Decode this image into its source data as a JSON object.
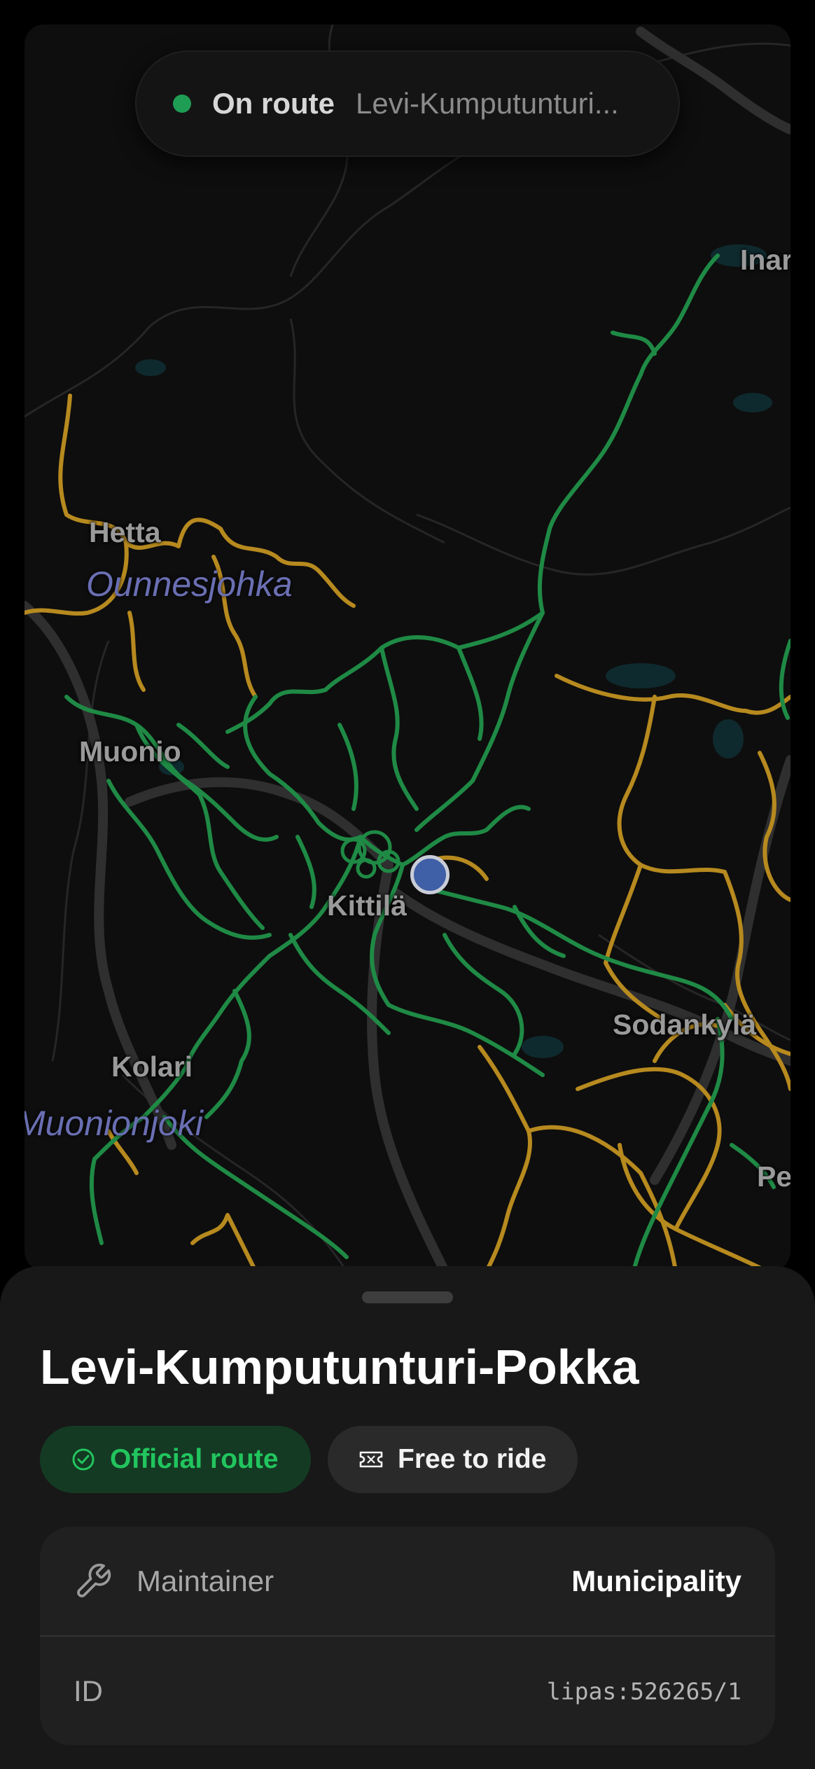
{
  "status": {
    "label": "On route",
    "route_preview": "Levi-Kumputunturi...",
    "indicator_color": "#1f9d55"
  },
  "map": {
    "places": [
      "Hetta",
      "Muonio",
      "Kittilä",
      "Kolari",
      "Sodankylä",
      "Inar",
      "Pe"
    ],
    "water_labels": [
      "Ounnesjohka",
      "Muonionjoki"
    ],
    "trail_colors": {
      "official": "#1f8a45",
      "other": "#b78a1f"
    }
  },
  "sheet": {
    "title": "Levi-Kumputunturi-Pokka",
    "chips": {
      "official": {
        "label": "Official route",
        "icon": "check-circle-icon"
      },
      "free": {
        "label": "Free to ride",
        "icon": "ticket-icon"
      }
    },
    "info": {
      "maintainer": {
        "label": "Maintainer",
        "value": "Municipality",
        "icon": "wrench-icon"
      },
      "id": {
        "label": "ID",
        "value": "lipas:526265/1"
      }
    }
  }
}
